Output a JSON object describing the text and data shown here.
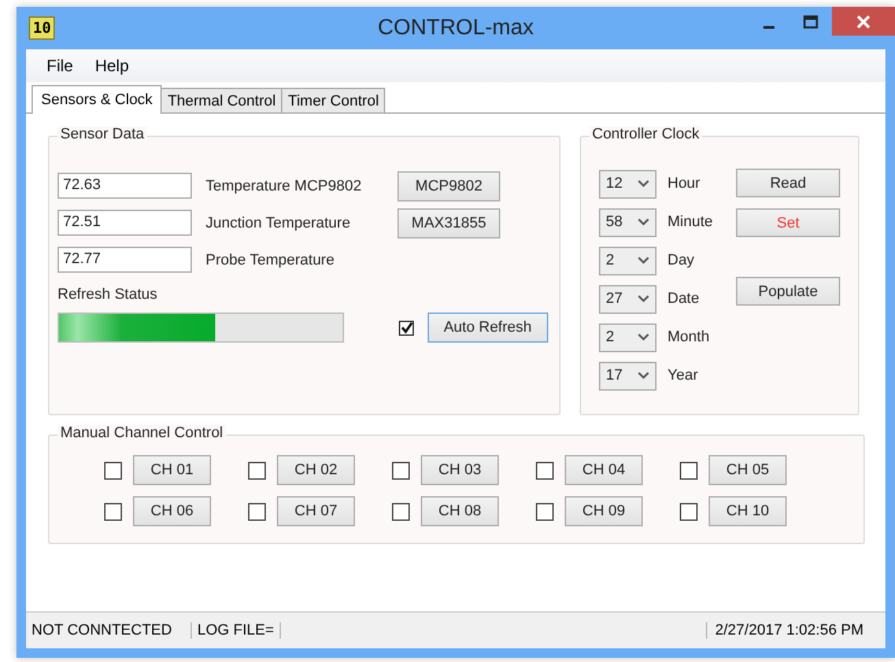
{
  "window": {
    "title": "CONTROL-max",
    "icon_text": "10"
  },
  "menu": [
    "File",
    "Help"
  ],
  "tabs": [
    {
      "label": "Sensors & Clock",
      "selected": true
    },
    {
      "label": "Thermal Control",
      "selected": false
    },
    {
      "label": "Timer Control",
      "selected": false
    }
  ],
  "sensor_data": {
    "title": "Sensor Data",
    "rows": [
      {
        "value": "72.63",
        "label": "Temperature MCP9802",
        "button": "MCP9802"
      },
      {
        "value": "72.51",
        "label": "Junction Temperature",
        "button": "MAX31855"
      },
      {
        "value": "72.77",
        "label": "Probe Temperature"
      }
    ],
    "refresh_label": "Refresh Status",
    "refresh_bar": {
      "level": 0.55
    },
    "auto_refresh": {
      "checked": true,
      "button": "Auto Refresh"
    }
  },
  "controller_clock": {
    "title": "Controller Clock",
    "fields": [
      {
        "value": "12",
        "label": "Hour"
      },
      {
        "value": "58",
        "label": "Minute"
      },
      {
        "value": "2",
        "label": "Day"
      },
      {
        "value": "27",
        "label": "Date"
      },
      {
        "value": "2",
        "label": "Month"
      },
      {
        "value": "17",
        "label": "Year"
      }
    ],
    "buttons": [
      {
        "label": "Read",
        "kind": "normal"
      },
      {
        "label": "Set",
        "kind": "warning"
      },
      {
        "label": "Populate",
        "kind": "normal"
      }
    ]
  },
  "manual_channel_control": {
    "title": "Manual Channel Control",
    "channels": [
      {
        "label": "CH 01",
        "checked": false
      },
      {
        "label": "CH 02",
        "checked": false
      },
      {
        "label": "CH 03",
        "checked": false
      },
      {
        "label": "CH 04",
        "checked": false
      },
      {
        "label": "CH 05",
        "checked": false
      },
      {
        "label": "CH 06",
        "checked": false
      },
      {
        "label": "CH 07",
        "checked": false
      },
      {
        "label": "CH 08",
        "checked": false
      },
      {
        "label": "CH 09",
        "checked": false
      },
      {
        "label": "CH 10",
        "checked": false
      }
    ]
  },
  "status_bar": {
    "connection": "NOT CONNTECTED",
    "log_file": "LOG FILE=",
    "datetime": "2/27/2017 1:02:56 PM"
  }
}
